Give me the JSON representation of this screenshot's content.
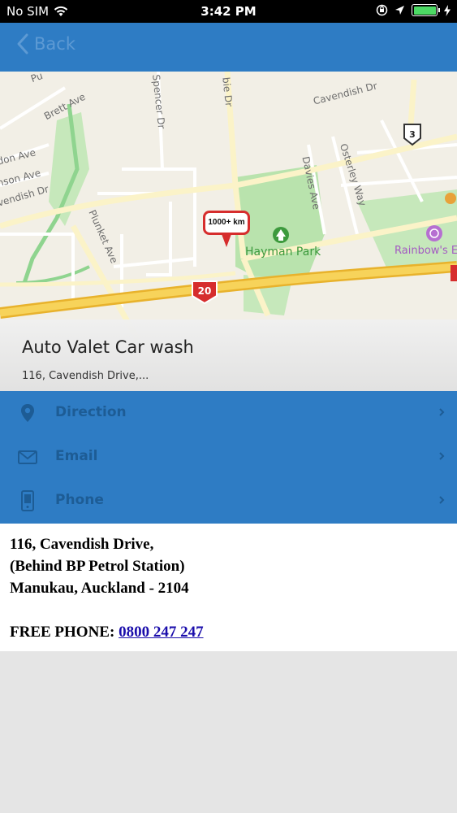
{
  "status_bar": {
    "carrier": "No SIM",
    "time": "3:42 PM"
  },
  "nav": {
    "back_label": "Back"
  },
  "map": {
    "streets": [
      "Cavendish Dr",
      "Brett Ave",
      "Spencer Dr",
      "bie Dr",
      "Davies Ave",
      "Osterley Way",
      "don Ave",
      "nson Ave",
      "vendish Dr",
      "Plunket Ave"
    ],
    "route_badges": [
      "3",
      "20"
    ],
    "park_label": "Hayman Park",
    "poi_label": "Rainbow's E",
    "pin_label": "1000+ km"
  },
  "location": {
    "name": "Auto Valet Car wash",
    "address_short": "116, Cavendish Drive,..."
  },
  "actions": [
    {
      "label": "Direction",
      "icon": "map-pin-icon"
    },
    {
      "label": "Email",
      "icon": "envelope-icon"
    },
    {
      "label": "Phone",
      "icon": "mobile-phone-icon"
    }
  ],
  "details": {
    "line1": "116, Cavendish Drive,",
    "line2": "(Behind BP Petrol Station)",
    "line3": "Manukau, Auckland - 2104",
    "phone_label": "FREE PHONE:",
    "phone_number": "0800 247 247"
  },
  "colors": {
    "primary": "#2e7cc4",
    "action_text": "#1d5c95",
    "pin": "#d62d2d",
    "park": "#8fd48f",
    "highway": "#f2c94c"
  }
}
